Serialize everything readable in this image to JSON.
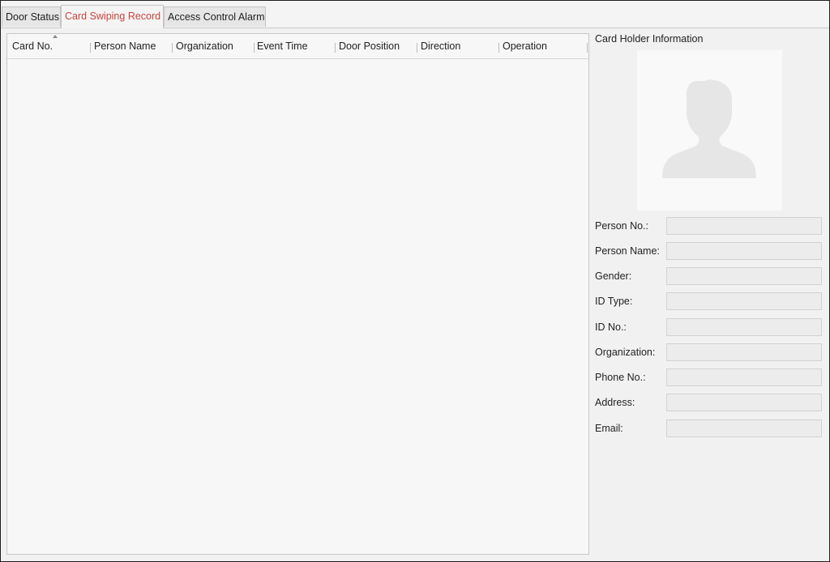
{
  "tabs": [
    {
      "label": "Door Status",
      "active": false
    },
    {
      "label": "Card Swiping Record",
      "active": true
    },
    {
      "label": "Access Control Alarm",
      "active": false
    }
  ],
  "table": {
    "columns": [
      "Card No.",
      "Person Name",
      "Organization",
      "Event Time",
      "Door Position",
      "Direction",
      "Operation"
    ],
    "sort_column": "Card No.",
    "rows": []
  },
  "card_holder": {
    "title": "Card Holder Information",
    "photo_icon": "person-silhouette-icon",
    "fields": [
      {
        "label": "Person No.:",
        "value": ""
      },
      {
        "label": "Person Name:",
        "value": ""
      },
      {
        "label": "Gender:",
        "value": ""
      },
      {
        "label": "ID Type:",
        "value": ""
      },
      {
        "label": "ID No.:",
        "value": ""
      },
      {
        "label": "Organization:",
        "value": ""
      },
      {
        "label": "Phone No.:",
        "value": ""
      },
      {
        "label": "Address:",
        "value": ""
      },
      {
        "label": "Email:",
        "value": ""
      }
    ]
  },
  "colors": {
    "active_tab_text": "#c8443c",
    "window_border": "#1e1e1e",
    "panel_background": "#f1f1f1"
  }
}
